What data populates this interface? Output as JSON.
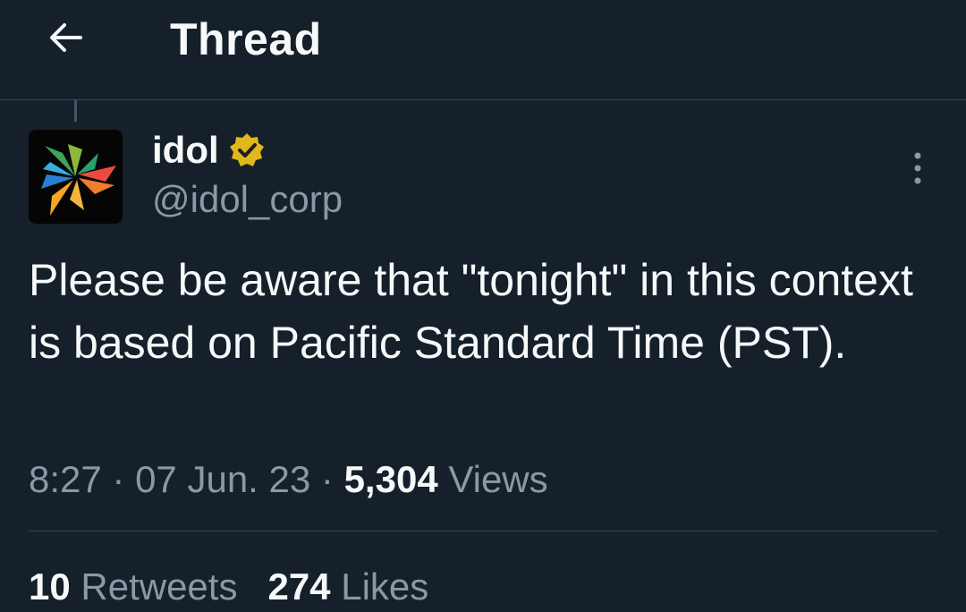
{
  "header": {
    "title": "Thread",
    "back_icon": "arrow-left-icon"
  },
  "tweet": {
    "author": {
      "display_name": "idol",
      "handle": "@idol_corp",
      "verified_badge": "verified-badge-icon",
      "verified_color": "#e2b719",
      "avatar_icon": "idol-logo-icon"
    },
    "more_icon": "more-vertical-icon",
    "text": "Please be aware that \"tonight\" in this context is based on Pacific Standard Time (PST).",
    "time": "8:27",
    "sep1": " · ",
    "date": "07 Jun. 23",
    "sep2": " · ",
    "views_count": "5,304",
    "views_label": " Views",
    "retweets_count": "10",
    "retweets_label": " Retweets",
    "likes_count": "274",
    "likes_label": " Likes"
  },
  "colors": {
    "background": "#15202b",
    "text": "#f7f9f9",
    "secondary_text": "#8b98a5",
    "divider": "#38444d"
  }
}
